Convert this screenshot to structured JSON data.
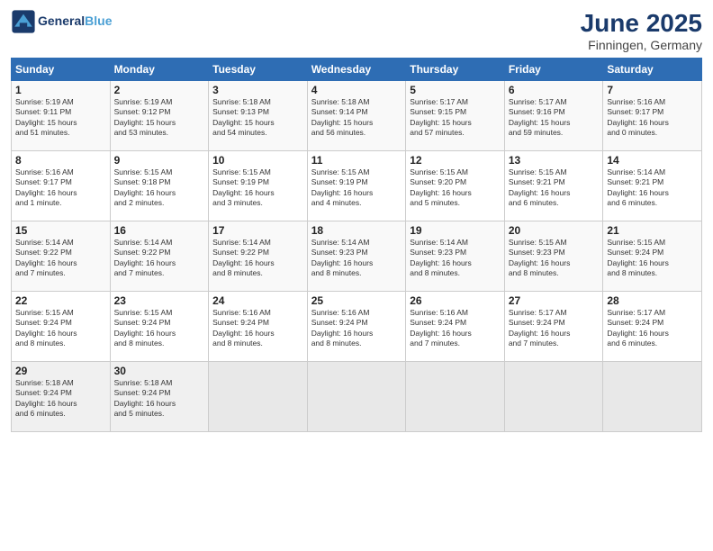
{
  "header": {
    "logo_line1": "General",
    "logo_line2": "Blue",
    "title": "June 2025",
    "subtitle": "Finningen, Germany"
  },
  "weekdays": [
    "Sunday",
    "Monday",
    "Tuesday",
    "Wednesday",
    "Thursday",
    "Friday",
    "Saturday"
  ],
  "weeks": [
    [
      {
        "day": "1",
        "info": "Sunrise: 5:19 AM\nSunset: 9:11 PM\nDaylight: 15 hours\nand 51 minutes."
      },
      {
        "day": "2",
        "info": "Sunrise: 5:19 AM\nSunset: 9:12 PM\nDaylight: 15 hours\nand 53 minutes."
      },
      {
        "day": "3",
        "info": "Sunrise: 5:18 AM\nSunset: 9:13 PM\nDaylight: 15 hours\nand 54 minutes."
      },
      {
        "day": "4",
        "info": "Sunrise: 5:18 AM\nSunset: 9:14 PM\nDaylight: 15 hours\nand 56 minutes."
      },
      {
        "day": "5",
        "info": "Sunrise: 5:17 AM\nSunset: 9:15 PM\nDaylight: 15 hours\nand 57 minutes."
      },
      {
        "day": "6",
        "info": "Sunrise: 5:17 AM\nSunset: 9:16 PM\nDaylight: 15 hours\nand 59 minutes."
      },
      {
        "day": "7",
        "info": "Sunrise: 5:16 AM\nSunset: 9:17 PM\nDaylight: 16 hours\nand 0 minutes."
      }
    ],
    [
      {
        "day": "8",
        "info": "Sunrise: 5:16 AM\nSunset: 9:17 PM\nDaylight: 16 hours\nand 1 minute."
      },
      {
        "day": "9",
        "info": "Sunrise: 5:15 AM\nSunset: 9:18 PM\nDaylight: 16 hours\nand 2 minutes."
      },
      {
        "day": "10",
        "info": "Sunrise: 5:15 AM\nSunset: 9:19 PM\nDaylight: 16 hours\nand 3 minutes."
      },
      {
        "day": "11",
        "info": "Sunrise: 5:15 AM\nSunset: 9:19 PM\nDaylight: 16 hours\nand 4 minutes."
      },
      {
        "day": "12",
        "info": "Sunrise: 5:15 AM\nSunset: 9:20 PM\nDaylight: 16 hours\nand 5 minutes."
      },
      {
        "day": "13",
        "info": "Sunrise: 5:15 AM\nSunset: 9:21 PM\nDaylight: 16 hours\nand 6 minutes."
      },
      {
        "day": "14",
        "info": "Sunrise: 5:14 AM\nSunset: 9:21 PM\nDaylight: 16 hours\nand 6 minutes."
      }
    ],
    [
      {
        "day": "15",
        "info": "Sunrise: 5:14 AM\nSunset: 9:22 PM\nDaylight: 16 hours\nand 7 minutes."
      },
      {
        "day": "16",
        "info": "Sunrise: 5:14 AM\nSunset: 9:22 PM\nDaylight: 16 hours\nand 7 minutes."
      },
      {
        "day": "17",
        "info": "Sunrise: 5:14 AM\nSunset: 9:22 PM\nDaylight: 16 hours\nand 8 minutes."
      },
      {
        "day": "18",
        "info": "Sunrise: 5:14 AM\nSunset: 9:23 PM\nDaylight: 16 hours\nand 8 minutes."
      },
      {
        "day": "19",
        "info": "Sunrise: 5:14 AM\nSunset: 9:23 PM\nDaylight: 16 hours\nand 8 minutes."
      },
      {
        "day": "20",
        "info": "Sunrise: 5:15 AM\nSunset: 9:23 PM\nDaylight: 16 hours\nand 8 minutes."
      },
      {
        "day": "21",
        "info": "Sunrise: 5:15 AM\nSunset: 9:24 PM\nDaylight: 16 hours\nand 8 minutes."
      }
    ],
    [
      {
        "day": "22",
        "info": "Sunrise: 5:15 AM\nSunset: 9:24 PM\nDaylight: 16 hours\nand 8 minutes."
      },
      {
        "day": "23",
        "info": "Sunrise: 5:15 AM\nSunset: 9:24 PM\nDaylight: 16 hours\nand 8 minutes."
      },
      {
        "day": "24",
        "info": "Sunrise: 5:16 AM\nSunset: 9:24 PM\nDaylight: 16 hours\nand 8 minutes."
      },
      {
        "day": "25",
        "info": "Sunrise: 5:16 AM\nSunset: 9:24 PM\nDaylight: 16 hours\nand 8 minutes."
      },
      {
        "day": "26",
        "info": "Sunrise: 5:16 AM\nSunset: 9:24 PM\nDaylight: 16 hours\nand 7 minutes."
      },
      {
        "day": "27",
        "info": "Sunrise: 5:17 AM\nSunset: 9:24 PM\nDaylight: 16 hours\nand 7 minutes."
      },
      {
        "day": "28",
        "info": "Sunrise: 5:17 AM\nSunset: 9:24 PM\nDaylight: 16 hours\nand 6 minutes."
      }
    ],
    [
      {
        "day": "29",
        "info": "Sunrise: 5:18 AM\nSunset: 9:24 PM\nDaylight: 16 hours\nand 6 minutes."
      },
      {
        "day": "30",
        "info": "Sunrise: 5:18 AM\nSunset: 9:24 PM\nDaylight: 16 hours\nand 5 minutes."
      },
      {
        "day": "",
        "info": ""
      },
      {
        "day": "",
        "info": ""
      },
      {
        "day": "",
        "info": ""
      },
      {
        "day": "",
        "info": ""
      },
      {
        "day": "",
        "info": ""
      }
    ]
  ]
}
